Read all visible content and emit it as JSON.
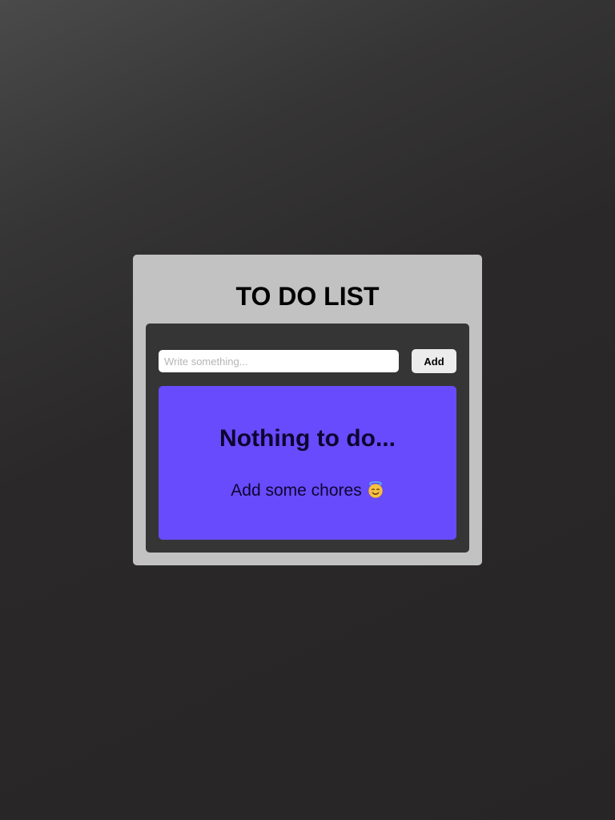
{
  "app": {
    "title": "TO DO LIST"
  },
  "input": {
    "placeholder": "Write something...",
    "value": ""
  },
  "add_button": {
    "label": "Add"
  },
  "empty_state": {
    "heading": "Nothing to do...",
    "message": "Add some chores",
    "icon": "smiling-face-with-halo-icon"
  },
  "colors": {
    "card_background": "#c2c2c2",
    "panel_background": "#353535",
    "empty_state_background": "#684bfc",
    "button_background": "#ececec"
  }
}
